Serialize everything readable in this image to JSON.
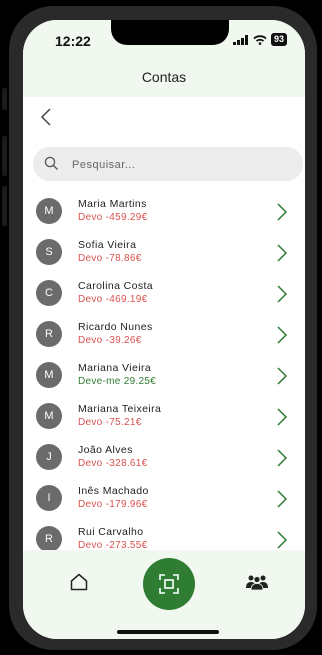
{
  "status": {
    "time": "12:22",
    "battery": "93"
  },
  "header": {
    "title": "Contas"
  },
  "search": {
    "placeholder": "Pesquisar..."
  },
  "contacts": [
    {
      "initial": "M",
      "name": "Maria Martins",
      "balance": "Devo -459.29€",
      "type": "neg"
    },
    {
      "initial": "S",
      "name": "Sofia Vieira",
      "balance": "Devo -78.86€",
      "type": "neg"
    },
    {
      "initial": "C",
      "name": "Carolina Costa",
      "balance": "Devo -469.19€",
      "type": "neg"
    },
    {
      "initial": "R",
      "name": "Ricardo Nunes",
      "balance": "Devo -39.26€",
      "type": "neg"
    },
    {
      "initial": "M",
      "name": "Mariana Vieira",
      "balance": "Deve-me 29.25€",
      "type": "pos"
    },
    {
      "initial": "M",
      "name": "Mariana Teixeira",
      "balance": "Devo -75.21€",
      "type": "neg"
    },
    {
      "initial": "J",
      "name": "João Alves",
      "balance": "Devo -328.61€",
      "type": "neg"
    },
    {
      "initial": "I",
      "name": "Inês Machado",
      "balance": "Devo -179.96€",
      "type": "neg"
    },
    {
      "initial": "R",
      "name": "Rui Carvalho",
      "balance": "Devo -273.55€",
      "type": "neg"
    }
  ],
  "nav": {
    "home_icon": "home-icon",
    "scan_icon": "scan-icon",
    "people_icon": "people-icon"
  },
  "colors": {
    "accent": "#2e7d32",
    "negative": "#d9534f",
    "positive": "#2e7d32",
    "bar_bg": "#f1f8ef"
  }
}
